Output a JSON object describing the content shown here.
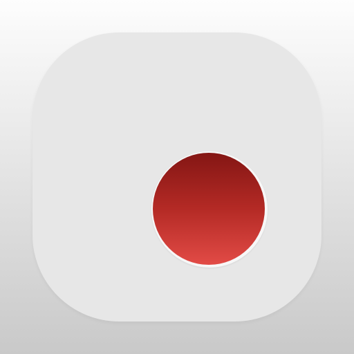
{
  "icon": {
    "name": "record-icon",
    "colors": {
      "background_top": "#fdfdfd",
      "background_bottom": "#c9c9c9",
      "tile": "#e7e7e7",
      "ring": "#f7f7f7",
      "dot_top": "#841614",
      "dot_bottom": "#e24b46"
    }
  }
}
